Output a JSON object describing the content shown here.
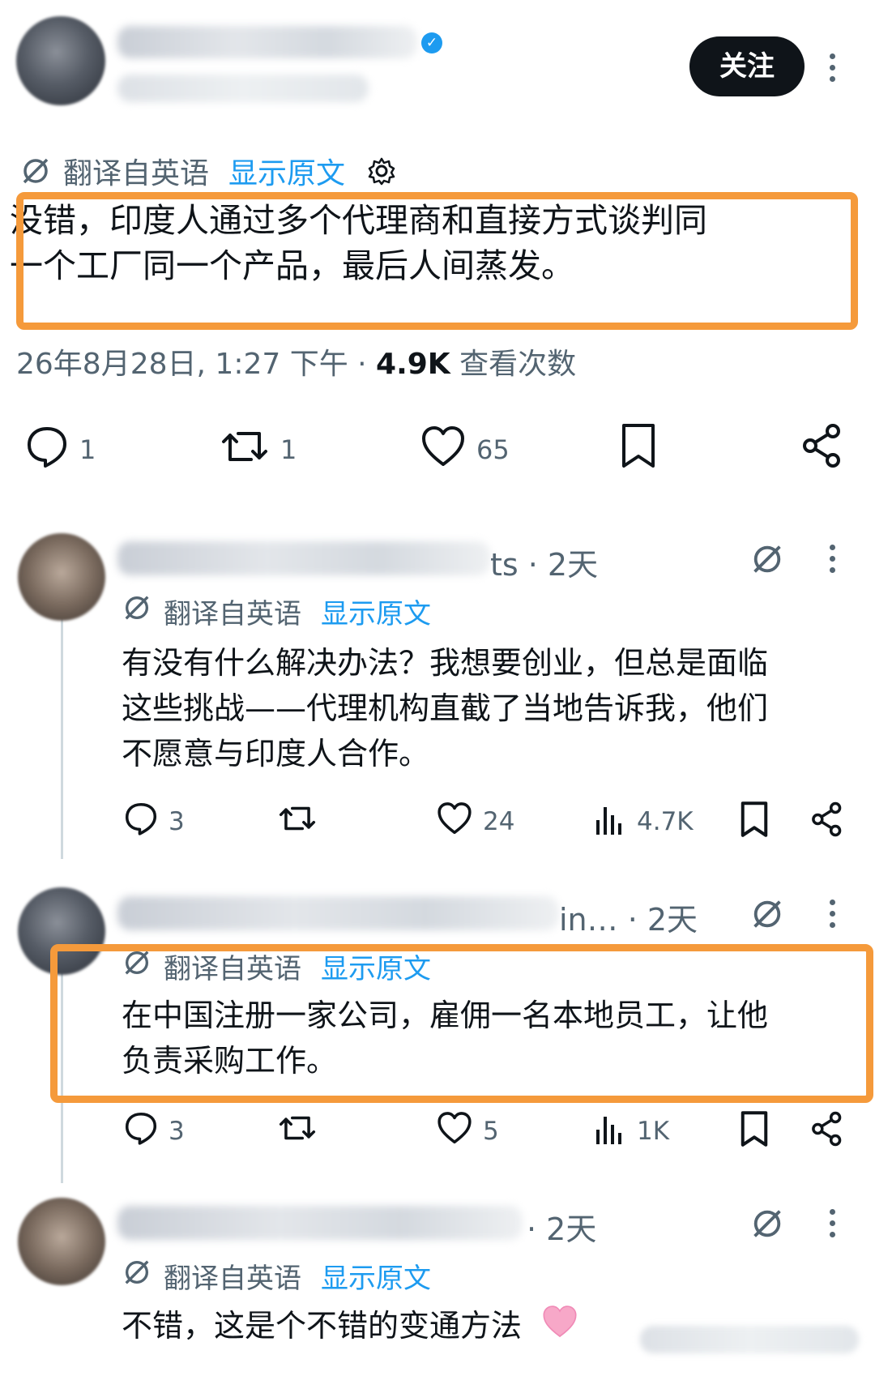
{
  "main_post": {
    "follow_label": "关注",
    "translated_from": "翻译自英语",
    "show_original": "显示原文",
    "text_line1": "没错，印度人通过多个代理商和直接方式谈判同",
    "text_line2": "一个工厂同一个产品，最后人间蒸发。",
    "timestamp": "26年8月28日, 1:27 下午 · ",
    "views_count": "4.9K",
    "views_label": " 查看次数",
    "actions": {
      "reply": "1",
      "retweet": "1",
      "like": "65"
    }
  },
  "replies": [
    {
      "handle_tail": "ts · 2天",
      "translated_from": "翻译自英语",
      "show_original": "显示原文",
      "lines": [
        "有没有什么解决办法？我想要创业，但总是面临",
        "这些挑战——代理机构直截了当地告诉我，他们",
        "不愿意与印度人合作。"
      ],
      "actions": {
        "reply": "3",
        "like": "24",
        "views": "4.7K"
      }
    },
    {
      "handle_tail": "in…  · 2天",
      "translated_from": "翻译自英语",
      "show_original": "显示原文",
      "lines": [
        "在中国注册一家公司，雇佣一名本地员工，让他",
        "负责采购工作。"
      ],
      "actions": {
        "reply": "3",
        "like": "5",
        "views": "1K"
      }
    },
    {
      "handle_tail": "· 2天",
      "translated_from": "翻译自英语",
      "show_original": "显示原文",
      "lines": [
        "不错，这是个不错的变通方法"
      ],
      "trailing_icon": "pink-heart-icon"
    }
  ],
  "colors": {
    "accent": "#1d9bf0",
    "highlight": "#f59a3b",
    "text": "#0f1419",
    "muted": "#536471"
  }
}
